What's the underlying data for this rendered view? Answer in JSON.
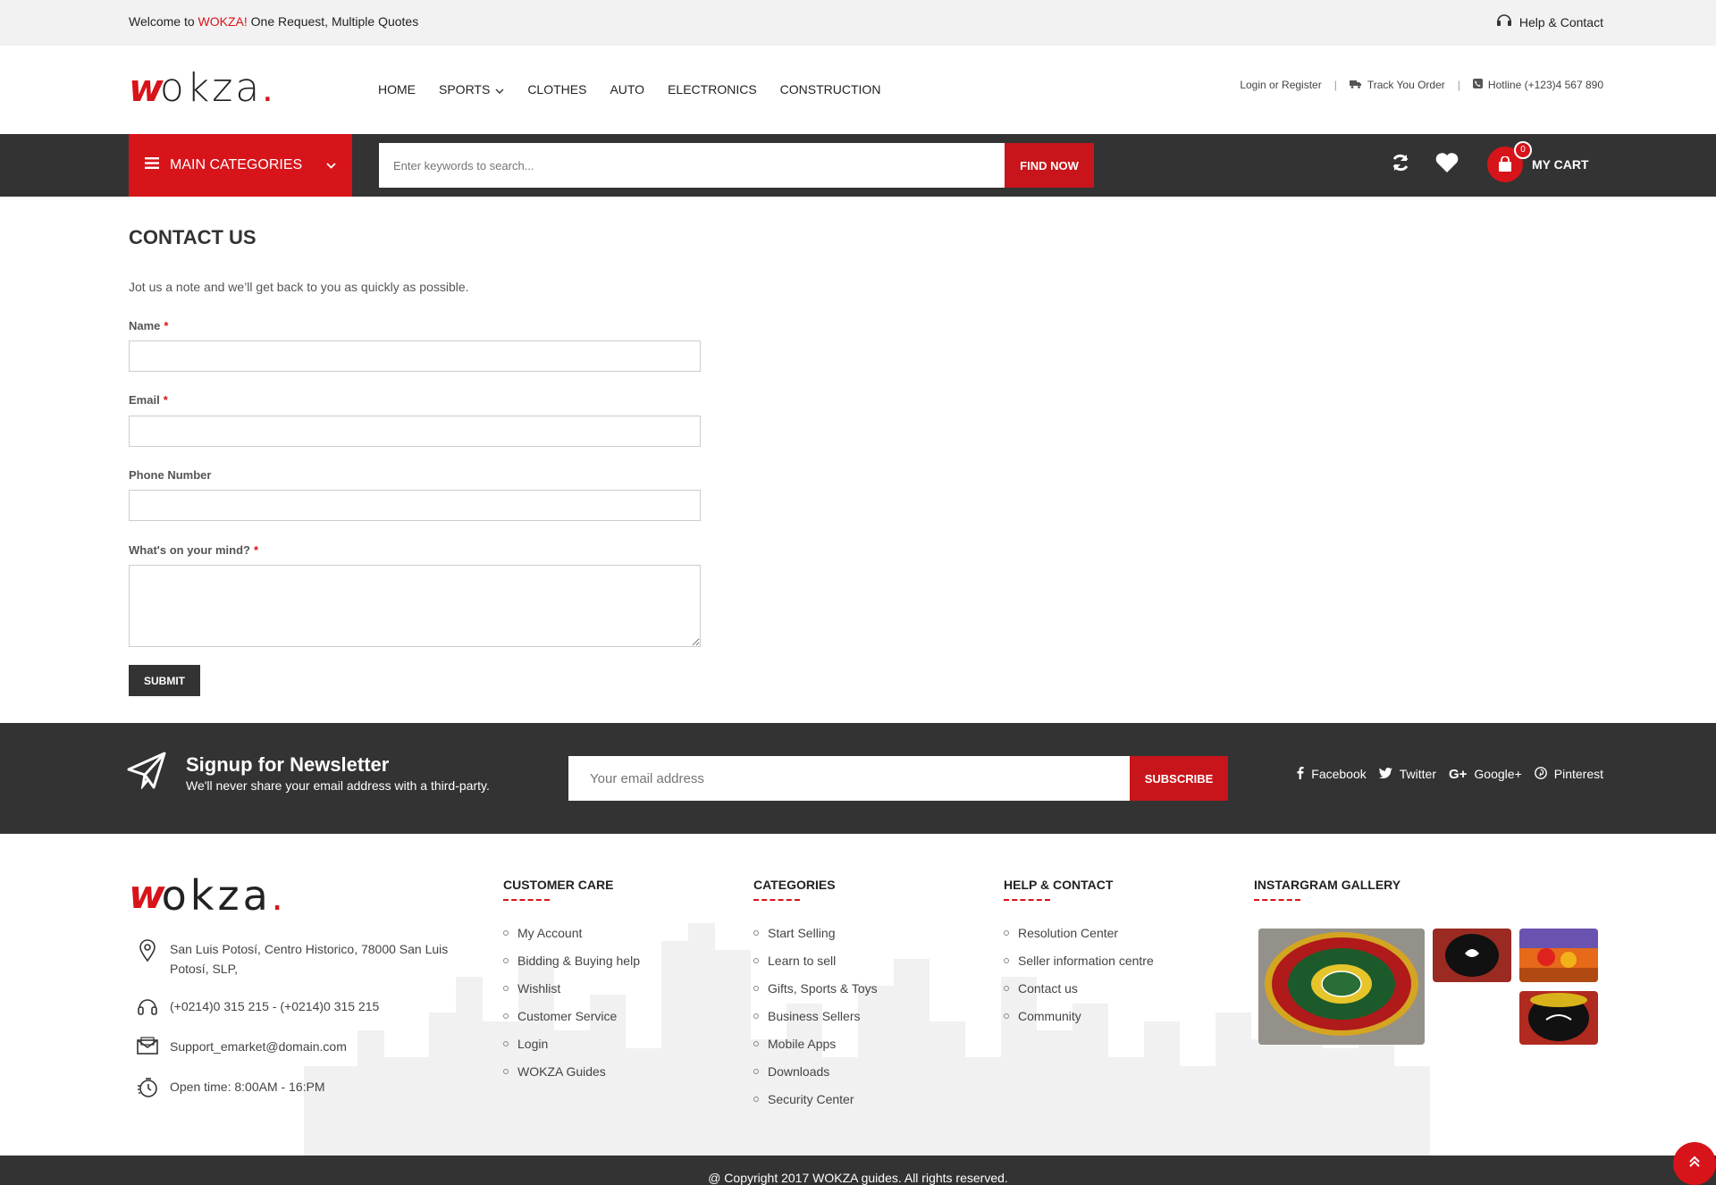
{
  "topbar": {
    "welcome_prefix": "Welcome to ",
    "welcome_brand": "WOKZA!",
    "welcome_suffix": " One Request, Multiple Quotes",
    "help_label": "Help & Contact"
  },
  "header": {
    "logo_text": "okza",
    "nav": [
      {
        "label": "HOME"
      },
      {
        "label": "SPORTS"
      },
      {
        "label": "CLOTHES"
      },
      {
        "label": "AUTO"
      },
      {
        "label": "ELECTRONICS"
      },
      {
        "label": "CONSTRUCTION"
      }
    ],
    "login": "Login or Register",
    "track": "Track You Order",
    "hotline": "Hotline (+123)4 567 890"
  },
  "catbar": {
    "categories_label": "MAIN CATEGORIES",
    "search_placeholder": "Enter keywords to search...",
    "find_label": "FIND NOW",
    "cart_label": "MY CART",
    "cart_count": "0"
  },
  "contact": {
    "title": "CONTACT US",
    "intro": "Jot us a note and we’ll get back to you as quickly as possible.",
    "name_label": "Name",
    "email_label": "Email",
    "phone_label": "Phone Number",
    "message_label": "What's on your mind?",
    "required_mark": "*",
    "submit_label": "SUBMIT"
  },
  "newsletter": {
    "title": "Signup for Newsletter",
    "subtitle": "We'll never share your email address with a third-party.",
    "placeholder": "Your email address",
    "button": "SUBSCRIBE",
    "social": [
      {
        "label": "Facebook",
        "icon": "facebook-icon"
      },
      {
        "label": "Twitter",
        "icon": "twitter-icon"
      },
      {
        "label": "Google+",
        "icon": "google-plus-icon"
      },
      {
        "label": "Pinterest",
        "icon": "pinterest-icon"
      }
    ]
  },
  "footer": {
    "logo_text": "okza",
    "address": "San Luis Potosí, Centro Historico, 78000 San Luis Potosí, SLP,",
    "phone": "(+0214)0 315 215 - (+0214)0 315 215",
    "email": "Support_emarket@domain.com",
    "open_time": "Open time: 8:00AM - 16:PM",
    "customer_care": {
      "title": "CUSTOMER CARE",
      "items": [
        "My Account",
        "Bidding & Buying help",
        "Wishlist",
        "Customer Service",
        "Login",
        "WOKZA Guides"
      ]
    },
    "categories": {
      "title": "CATEGORIES",
      "items": [
        "Start Selling",
        "Learn to sell",
        "Gifts, Sports & Toys",
        "Business Sellers",
        "Mobile Apps",
        "Downloads",
        "Security Center"
      ]
    },
    "help": {
      "title": "HELP & CONTACT",
      "items": [
        "Resolution Center",
        "Seller information centre",
        "Contact us",
        "Community"
      ]
    },
    "gallery": {
      "title": "INSTARGRAM GALLERY"
    },
    "copyright": "@ Copyright 2017 WOKZA guides. All rights reserved."
  },
  "colors": {
    "brand_red": "#d7141a",
    "dark_bar": "#333333"
  }
}
